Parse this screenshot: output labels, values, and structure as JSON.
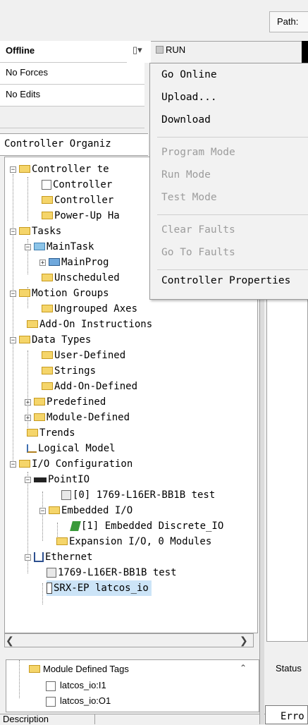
{
  "top": {
    "path_label": "Path:",
    "status_offline": "Offline",
    "status_forces": "No Forces",
    "status_edits": "No Edits",
    "run_label": "RUN"
  },
  "context_menu": {
    "items": [
      {
        "label": "Go Online",
        "enabled": true
      },
      {
        "label": "Upload...",
        "enabled": true
      },
      {
        "label": "Download",
        "enabled": true
      },
      {
        "label": "Program Mode",
        "enabled": false
      },
      {
        "label": "Run Mode",
        "enabled": false
      },
      {
        "label": "Test Mode",
        "enabled": false
      },
      {
        "label": "Clear Faults",
        "enabled": false
      },
      {
        "label": "Go To Faults",
        "enabled": false
      },
      {
        "label": "Controller Properties",
        "enabled": true
      }
    ]
  },
  "organizer": {
    "title": "Controller Organiz",
    "tree": [
      {
        "label": "Controller te",
        "icon": "folder-icon"
      },
      {
        "label": "Controller",
        "icon": "doc-edit-icon"
      },
      {
        "label": "Controller",
        "icon": "folder-icon"
      },
      {
        "label": "Power-Up Ha",
        "icon": "folder-icon"
      },
      {
        "label": "Tasks",
        "icon": "folder-icon"
      },
      {
        "label": "MainTask",
        "icon": "task-icon"
      },
      {
        "label": "MainProg",
        "icon": "program-icon"
      },
      {
        "label": "Unscheduled",
        "icon": "folder-icon"
      },
      {
        "label": "Motion Groups",
        "icon": "folder-icon"
      },
      {
        "label": "Ungrouped Axes",
        "icon": "folder-icon"
      },
      {
        "label": "Add-On Instructions",
        "icon": "folder-icon"
      },
      {
        "label": "Data Types",
        "icon": "folder-icon"
      },
      {
        "label": "User-Defined",
        "icon": "datatype-icon"
      },
      {
        "label": "Strings",
        "icon": "datatype-icon"
      },
      {
        "label": "Add-On-Defined",
        "icon": "datatype-icon"
      },
      {
        "label": "Predefined",
        "icon": "datatype-icon"
      },
      {
        "label": "Module-Defined",
        "icon": "datatype-icon"
      },
      {
        "label": "Trends",
        "icon": "folder-icon"
      },
      {
        "label": "Logical Model",
        "icon": "logical-model-icon"
      },
      {
        "label": "I/O Configuration",
        "icon": "folder-icon"
      },
      {
        "label": "PointIO",
        "icon": "backplane-icon"
      },
      {
        "label": "[0] 1769-L16ER-BB1B test",
        "icon": "module-icon"
      },
      {
        "label": "Embedded I/O",
        "icon": "folder-icon"
      },
      {
        "label": "[1] Embedded Discrete_IO",
        "icon": "discrete-io-icon"
      },
      {
        "label": "Expansion I/O, 0 Modules",
        "icon": "folder-icon"
      },
      {
        "label": "Ethernet",
        "icon": "network-icon"
      },
      {
        "label": "1769-L16ER-BB1B test",
        "icon": "module-icon"
      },
      {
        "label": "SRX-EP latcos_io",
        "icon": "device-icon"
      }
    ]
  },
  "mini_panel": {
    "title": "Module Defined Tags",
    "items": [
      "latcos_io:I1",
      "latcos_io:O1"
    ]
  },
  "bottom": {
    "description_label": "Description",
    "status_label": "Status",
    "errors_tab": "Erro"
  }
}
